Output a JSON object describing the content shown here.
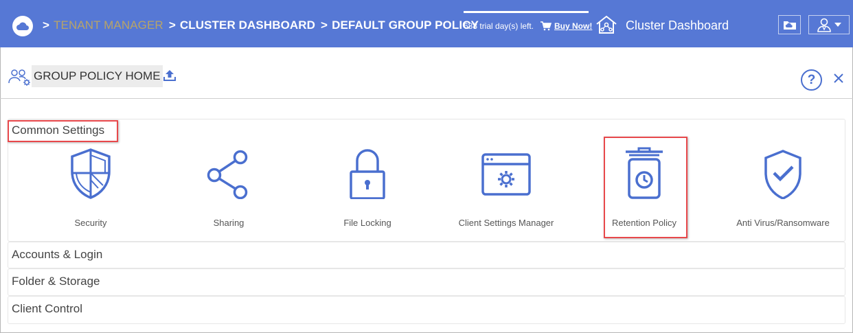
{
  "header": {
    "breadcrumb": {
      "separator": ">",
      "tenant_manager": "TENANT MANAGER",
      "cluster_dashboard": "CLUSTER DASHBOARD",
      "current": "DEFAULT GROUP POLICY"
    },
    "trial_text": "688 trial day(s) left.",
    "buy_now": "Buy Now!",
    "title": "Cluster Dashboard",
    "icons": [
      "cloud-logo-icon",
      "shopping-cart-icon",
      "home-network-icon",
      "cloud-folder-icon",
      "user-icon",
      "caret-down-icon"
    ]
  },
  "subheader": {
    "title": "GROUP POLICY HOME",
    "help_label": "?",
    "icons": [
      "group-policy-icon",
      "upload-icon",
      "help-icon",
      "close-icon"
    ]
  },
  "sections": {
    "common": {
      "title": "Common Settings",
      "tiles": [
        {
          "label": "Security",
          "icon": "shield-icon"
        },
        {
          "label": "Sharing",
          "icon": "share-icon"
        },
        {
          "label": "File Locking",
          "icon": "lock-icon"
        },
        {
          "label": "Client Settings Manager",
          "icon": "settings-window-icon"
        },
        {
          "label": "Retention Policy",
          "icon": "retention-bin-icon"
        },
        {
          "label": "Anti Virus/Ransomware",
          "icon": "shield-check-icon"
        }
      ]
    },
    "accounts": {
      "title": "Accounts & Login"
    },
    "folder": {
      "title": "Folder & Storage"
    },
    "client": {
      "title": "Client Control"
    }
  },
  "colors": {
    "header_bg": "#5678d5",
    "accent_blue": "#4a6fcf",
    "tenant_manager_text": "#b8a468",
    "highlight_red": "#e8484b"
  }
}
